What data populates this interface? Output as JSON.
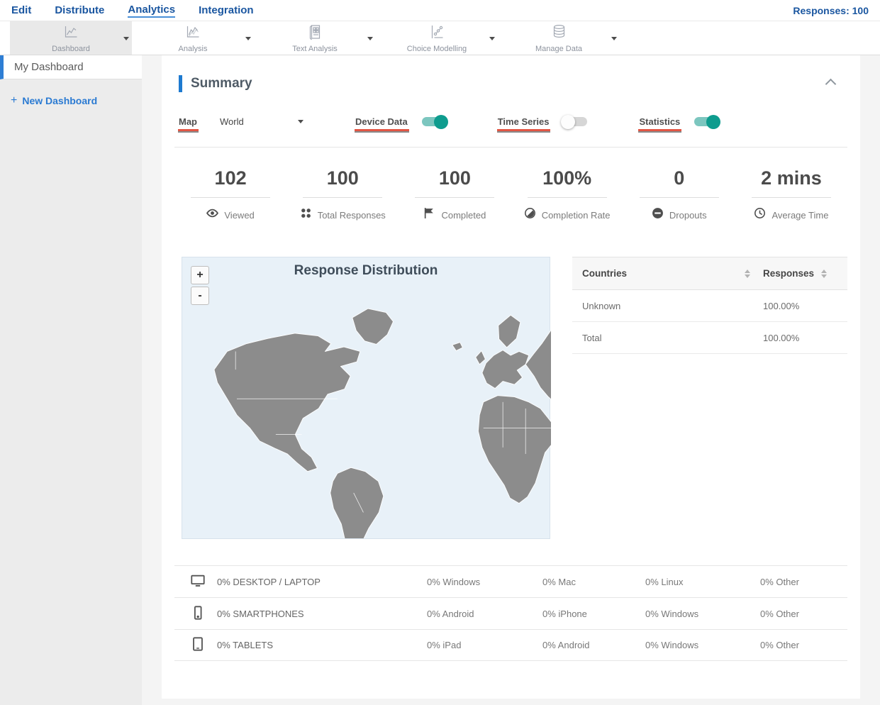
{
  "nav": {
    "items": [
      {
        "label": "Edit",
        "active": false
      },
      {
        "label": "Distribute",
        "active": false
      },
      {
        "label": "Analytics",
        "active": true
      },
      {
        "label": "Integration",
        "active": false
      }
    ],
    "responses_label": "Responses: 100"
  },
  "toolbar": {
    "items": [
      {
        "label": "Dashboard",
        "icon": "line-chart-icon",
        "selected": true
      },
      {
        "label": "Analysis",
        "icon": "line-chart-icon",
        "selected": false
      },
      {
        "label": "Text Analysis",
        "icon": "document-grid-icon",
        "selected": false
      },
      {
        "label": "Choice Modelling",
        "icon": "scatter-chart-icon",
        "selected": false
      },
      {
        "label": "Manage Data",
        "icon": "database-icon",
        "selected": false
      }
    ]
  },
  "sidebar": {
    "selected_item": "My Dashboard",
    "new_dashboard": {
      "plus": "+",
      "label": "New Dashboard"
    }
  },
  "summary": {
    "title": "Summary",
    "controls": {
      "map_label": "Map",
      "map_value": "World",
      "toggles": [
        {
          "label": "Device Data",
          "on": true
        },
        {
          "label": "Time Series",
          "on": false
        },
        {
          "label": "Statistics",
          "on": true
        }
      ]
    },
    "stats": [
      {
        "value": "102",
        "label": "Viewed",
        "icon": "eye-icon"
      },
      {
        "value": "100",
        "label": "Total Responses",
        "icon": "dots-grid-icon"
      },
      {
        "value": "100",
        "label": "Completed",
        "icon": "flag-icon"
      },
      {
        "value": "100%",
        "label": "Completion Rate",
        "icon": "contrast-icon"
      },
      {
        "value": "0",
        "label": "Dropouts",
        "icon": "minus-circle-icon"
      },
      {
        "value": "2 mins",
        "label": "Average Time",
        "icon": "clock-icon"
      }
    ],
    "map": {
      "title": "Response Distribution",
      "zoom_in": "+",
      "zoom_out": "-"
    },
    "countries_table": {
      "col_countries": "Countries",
      "col_responses": "Responses",
      "rows": [
        {
          "country": "Unknown",
          "responses": "100.00%"
        },
        {
          "country": "Total",
          "responses": "100.00%"
        }
      ]
    },
    "device_table": {
      "rows": [
        {
          "icon": "desktop-icon",
          "device": "0% DESKTOP / LAPTOP",
          "col1": "0% Windows",
          "col2": "0% Mac",
          "col3": "0% Linux",
          "col4": "0% Other"
        },
        {
          "icon": "smartphone-icon",
          "device": "0% SMARTPHONES",
          "col1": "0% Android",
          "col2": "0% iPhone",
          "col3": "0% Windows",
          "col4": "0% Other"
        },
        {
          "icon": "tablet-icon",
          "device": "0% TABLETS",
          "col1": "0% iPad",
          "col2": "0% Android",
          "col3": "0% Windows",
          "col4": "0% Other"
        }
      ]
    }
  },
  "colors": {
    "nav_blue": "#1a56a0",
    "accent_blue": "#1e7ad0",
    "link_blue": "#2a7ad2",
    "toggle_on_teal": "#0e9c8e",
    "underline_red": "#e25544",
    "map_background": "#e8f1f8",
    "map_land_gray": "#8c8c8c"
  }
}
